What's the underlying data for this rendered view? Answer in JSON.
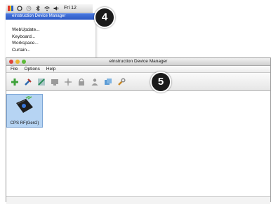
{
  "mac_menubar": {
    "clock": "Fri 12",
    "icons": [
      "app-icon",
      "sync-icon",
      "time-machine-icon",
      "bluetooth-icon",
      "wifi-icon",
      "volume-icon"
    ]
  },
  "dropdown": {
    "header": "eInstruction Device Manager",
    "items": [
      "WebUpdate...",
      "Keyboard...",
      "Workspace...",
      "Curtain..."
    ]
  },
  "callouts": {
    "four": "4",
    "five": "5"
  },
  "window": {
    "title": "eInstruction Device Manager",
    "menu": [
      "File",
      "Options",
      "Help"
    ],
    "toolbar_icons": [
      "add-device-icon",
      "remove-device-icon",
      "connect-icon",
      "monitor-icon",
      "network-icon",
      "lock-icon",
      "user-icon",
      "settings-icon",
      "wrench-icon"
    ]
  },
  "device": {
    "label": "CPS RF(Gen2)"
  },
  "colors": {
    "selection": "#b6d4f3",
    "menu_highlight": "#2c58c4",
    "callout": "#1b1b1b"
  }
}
